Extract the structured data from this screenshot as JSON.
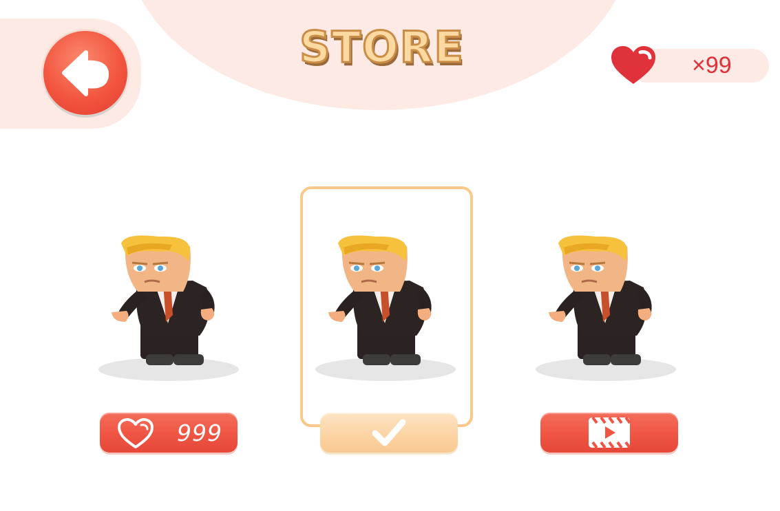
{
  "header": {
    "title": "STORE"
  },
  "hearts": {
    "count": "×99",
    "icon": "heart-icon"
  },
  "back": {
    "icon": "back-arrow-icon"
  },
  "store_items": [
    {
      "name": "character-1",
      "button_type": "buy",
      "price": "999",
      "icon": "heart-icon",
      "selected": false
    },
    {
      "name": "character-2",
      "button_type": "equipped",
      "icon": "checkmark-icon",
      "selected": true
    },
    {
      "name": "character-3",
      "button_type": "watch-video",
      "icon": "video-icon",
      "selected": false
    }
  ],
  "colors": {
    "accent_red": "#ef5542",
    "accent_orange": "#fcd3a2",
    "panel_pink": "#fdeae5",
    "frame": "#f9c98a"
  }
}
